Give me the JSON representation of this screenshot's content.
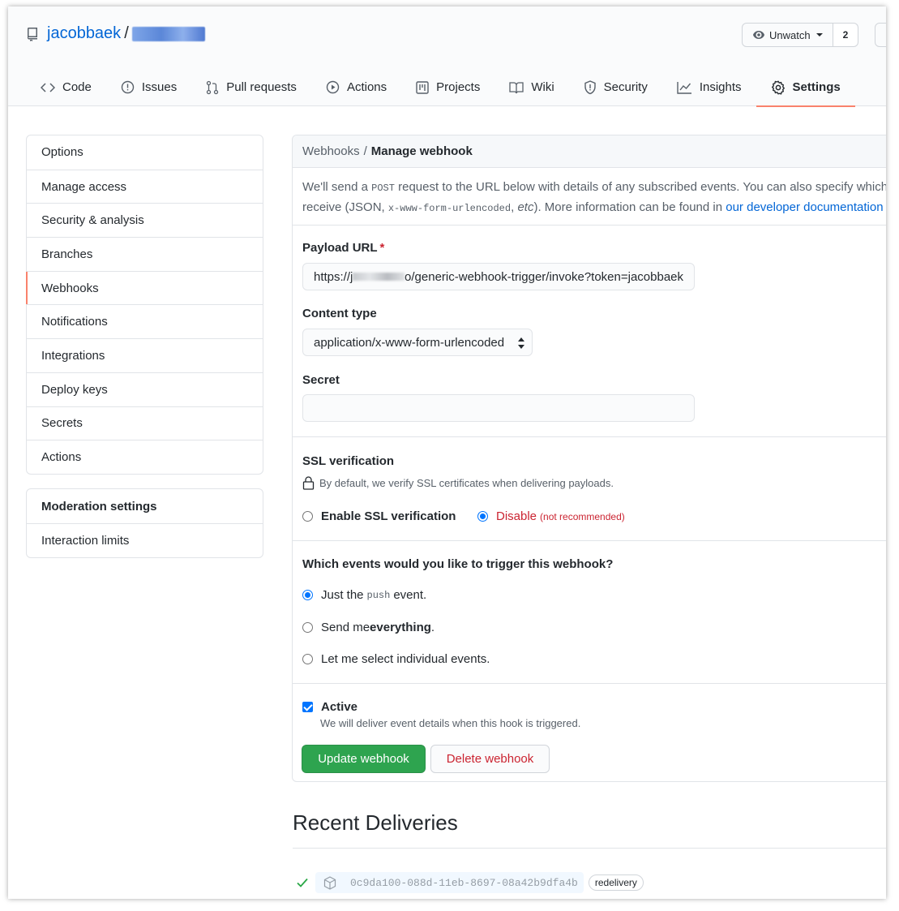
{
  "repo": {
    "owner": "jacobbaek",
    "separator": "/",
    "name": ""
  },
  "watch": {
    "label": "Unwatch",
    "count": "2"
  },
  "tabs": [
    {
      "label": "Code",
      "icon": "code-icon"
    },
    {
      "label": "Issues",
      "icon": "issue-icon"
    },
    {
      "label": "Pull requests",
      "icon": "pull-request-icon"
    },
    {
      "label": "Actions",
      "icon": "play-icon"
    },
    {
      "label": "Projects",
      "icon": "project-icon"
    },
    {
      "label": "Wiki",
      "icon": "book-icon"
    },
    {
      "label": "Security",
      "icon": "shield-icon"
    },
    {
      "label": "Insights",
      "icon": "graph-icon"
    },
    {
      "label": "Settings",
      "icon": "gear-icon",
      "selected": true
    }
  ],
  "sidebar": {
    "items": [
      "Options",
      "Manage access",
      "Security & analysis",
      "Branches",
      "Webhooks",
      "Notifications",
      "Integrations",
      "Deploy keys",
      "Secrets",
      "Actions"
    ],
    "selected": "Webhooks",
    "moderation": {
      "heading": "Moderation settings",
      "items": [
        "Interaction limits"
      ]
    }
  },
  "breadcrumb": {
    "parent": "Webhooks",
    "separator": "/",
    "current": "Manage webhook"
  },
  "intro": {
    "line1_a": "We'll send a ",
    "line1_code": "POST",
    "line1_b": " request to the URL below with details of any subscribed events. You can also specify which data format you'd like to",
    "line2_a": "receive (JSON, ",
    "line2_code": "x-www-form-urlencoded",
    "line2_b": ", ",
    "line2_em": "etc",
    "line2_c": "). More information can be found in ",
    "line2_link": "our developer documentation"
  },
  "form": {
    "payload_label": "Payload URL",
    "required_mark": "*",
    "payload_prefix": "https://j",
    "payload_suffix": "o/generic-webhook-trigger/invoke?token=jacobbaek",
    "content_type_label": "Content type",
    "content_type_value": "application/x-www-form-urlencoded",
    "secret_label": "Secret",
    "secret_value": ""
  },
  "ssl": {
    "heading": "SSL verification",
    "note": "By default, we verify SSL certificates when delivering payloads.",
    "enable_label": "Enable SSL verification",
    "disable_label": "Disable",
    "disable_note": "(not recommended)",
    "selected": "disable"
  },
  "events": {
    "question": "Which events would you like to trigger this webhook?",
    "opt1_a": "Just the",
    "opt1_code": "push",
    "opt1_b": "event.",
    "opt2_a": "Send me ",
    "opt2_strong": "everything",
    "opt2_b": ".",
    "opt3": "Let me select individual events.",
    "selected": "push"
  },
  "active": {
    "label": "Active",
    "note": "We will deliver event details when this hook is triggered.",
    "checked": true
  },
  "buttons": {
    "update": "Update webhook",
    "delete": "Delete webhook"
  },
  "deliveries": {
    "title": "Recent Deliveries",
    "items": [
      {
        "status": "success",
        "guid": "0c9da100-088d-11eb-8697-08a42b9dfa4b",
        "tag": "redelivery"
      }
    ]
  },
  "colors": {
    "accent": "#0366d6",
    "selected_tab_underline": "#f9826c",
    "primary_button": "#2ea44f",
    "danger": "#cb2431"
  }
}
